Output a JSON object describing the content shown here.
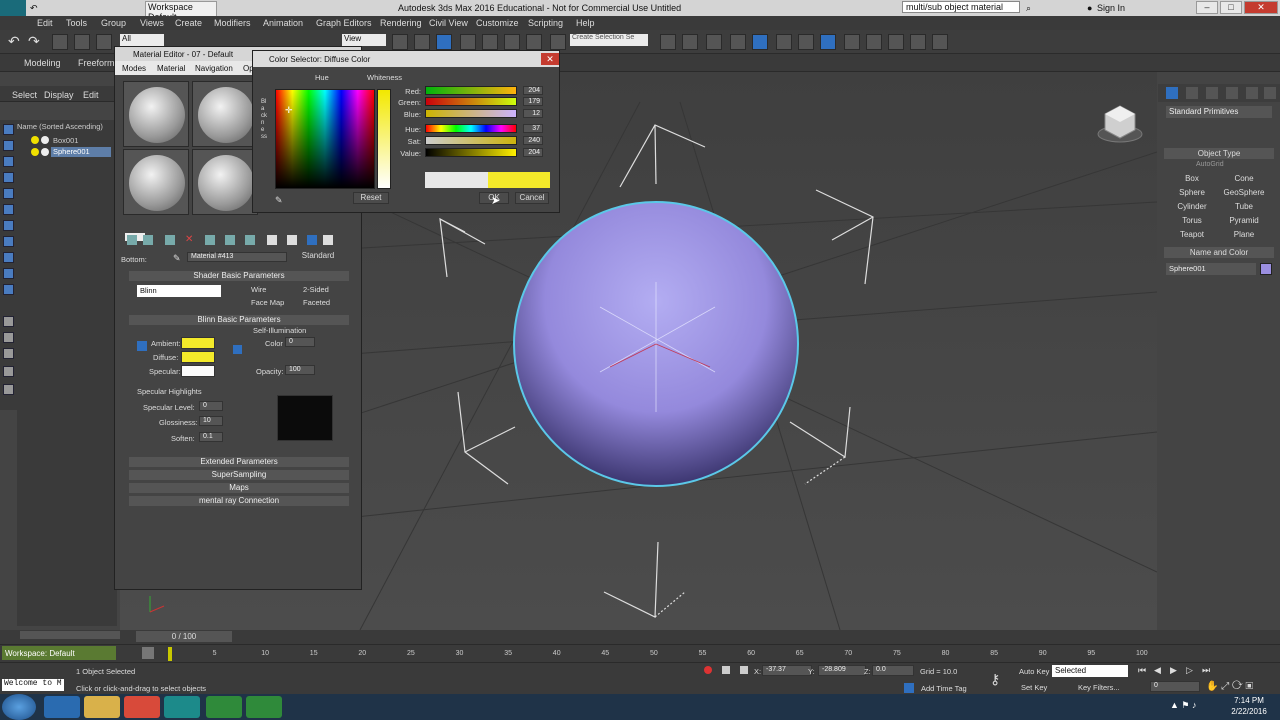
{
  "window": {
    "workspace": "Workspace Default",
    "title": "Autodesk 3ds Max 2016 Educational - Not for Commercial Use   Untitled",
    "search_value": "multi/sub object material",
    "sign_in": "Sign In"
  },
  "menu": [
    "Edit",
    "Tools",
    "Group",
    "Views",
    "Create",
    "Modifiers",
    "Animation",
    "Graph Editors",
    "Rendering",
    "Civil View",
    "Customize",
    "Scripting",
    "Help"
  ],
  "toolbar": {
    "selection_filter": "All",
    "view_dropdown": "View",
    "selection_set": "Create Selection Se"
  },
  "ribbon": {
    "tab1": "Modeling",
    "tab2": "Freeform"
  },
  "scene_explorer": {
    "tabs": [
      "Select",
      "Display",
      "Edit"
    ],
    "header": "Name (Sorted Ascending)",
    "items": [
      "Box001",
      "Sphere001"
    ]
  },
  "material_editor": {
    "title": "Material Editor - 07 - Default",
    "menu": [
      "Modes",
      "Material",
      "Navigation",
      "Op"
    ],
    "bottom_label": "Bottom:",
    "material_name": "Material #413",
    "material_type": "Standard",
    "shader_rollout": "Shader Basic Parameters",
    "shader": "Blinn",
    "checks": [
      "Wire",
      "2-Sided",
      "Face Map",
      "Faceted"
    ],
    "blinn_rollout": "Blinn Basic Parameters",
    "self_illum": "Self-Illumination",
    "color_label": "Color",
    "color_value": "0",
    "ambient": "Ambient:",
    "diffuse": "Diffuse:",
    "specular": "Specular:",
    "opacity_label": "Opacity:",
    "opacity_value": "100",
    "highlights": "Specular Highlights",
    "spec_level_label": "Specular Level:",
    "spec_level": "0",
    "gloss_label": "Glossiness:",
    "gloss": "10",
    "soften_label": "Soften:",
    "soften": "0.1",
    "rollouts": [
      "Extended Parameters",
      "SuperSampling",
      "Maps",
      "mental ray Connection"
    ]
  },
  "color_selector": {
    "title": "Color Selector: Diffuse Color",
    "hue_label": "Hue",
    "whiteness_label": "Whiteness",
    "blackness_label": "Blackness",
    "channels": [
      {
        "label": "Red:",
        "value": "204"
      },
      {
        "label": "Green:",
        "value": "179"
      },
      {
        "label": "Blue:",
        "value": "12"
      },
      {
        "label": "Hue:",
        "value": "37"
      },
      {
        "label": "Sat:",
        "value": "240"
      },
      {
        "label": "Value:",
        "value": "204"
      }
    ],
    "reset": "Reset",
    "ok": "OK",
    "cancel": "Cancel"
  },
  "command_panel": {
    "dropdown": "Standard Primitives",
    "object_type": "Object Type",
    "autogrid": "AutoGrid",
    "buttons": [
      "Box",
      "Cone",
      "Sphere",
      "GeoSphere",
      "Cylinder",
      "Tube",
      "Torus",
      "Pyramid",
      "Teapot",
      "Plane"
    ],
    "name_color": "Name and Color",
    "object_name": "Sphere001"
  },
  "timeline": {
    "frame": "0 / 100",
    "ticks": [
      "5",
      "10",
      "15",
      "20",
      "25",
      "30",
      "35",
      "40",
      "45",
      "50",
      "55",
      "60",
      "65",
      "70",
      "75",
      "80",
      "85",
      "90",
      "95",
      "100"
    ]
  },
  "status": {
    "workspace": "Workspace: Default",
    "selected": "1 Object Selected",
    "prompt": "Click or click-and-drag to select objects",
    "script": "Welcome to M",
    "x_label": "X:",
    "x": "-37.37",
    "y_label": "Y:",
    "y": "-28.809",
    "z_label": "Z:",
    "z": "0.0",
    "grid": "Grid = 10.0",
    "add_time_tag": "Add Time Tag",
    "auto_key": "Auto Key",
    "set_key": "Set Key",
    "key_mode": "Selected",
    "key_filters": "Key Filters...",
    "frame_field": "0"
  },
  "clock": {
    "time": "7:14 PM",
    "date": "2/22/2016"
  },
  "colors": {
    "diffuse": "#ccb30c",
    "sphere": "#9b8fe0",
    "selection": "#5bc8e8"
  }
}
